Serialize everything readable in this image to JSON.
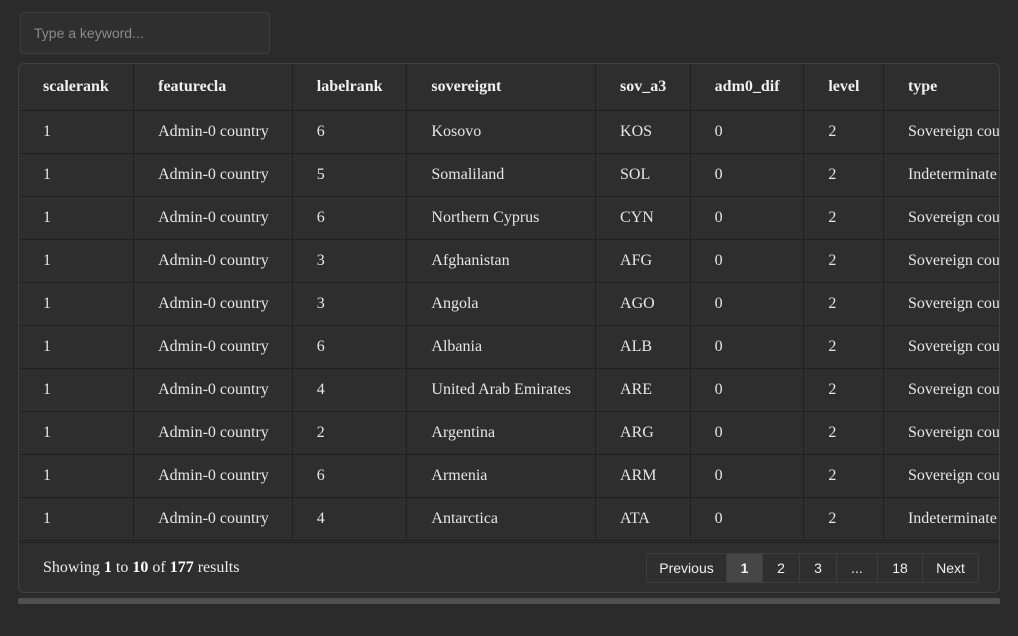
{
  "search": {
    "placeholder": "Type a keyword..."
  },
  "table": {
    "columns": [
      "scalerank",
      "featurecla",
      "labelrank",
      "sovereignt",
      "sov_a3",
      "adm0_dif",
      "level",
      "type"
    ],
    "rows": [
      [
        "1",
        "Admin-0 country",
        "6",
        "Kosovo",
        "KOS",
        "0",
        "2",
        "Sovereign cou"
      ],
      [
        "1",
        "Admin-0 country",
        "5",
        "Somaliland",
        "SOL",
        "0",
        "2",
        "Indeterminate"
      ],
      [
        "1",
        "Admin-0 country",
        "6",
        "Northern Cyprus",
        "CYN",
        "0",
        "2",
        "Sovereign cou"
      ],
      [
        "1",
        "Admin-0 country",
        "3",
        "Afghanistan",
        "AFG",
        "0",
        "2",
        "Sovereign cou"
      ],
      [
        "1",
        "Admin-0 country",
        "3",
        "Angola",
        "AGO",
        "0",
        "2",
        "Sovereign cou"
      ],
      [
        "1",
        "Admin-0 country",
        "6",
        "Albania",
        "ALB",
        "0",
        "2",
        "Sovereign cou"
      ],
      [
        "1",
        "Admin-0 country",
        "4",
        "United Arab Emirates",
        "ARE",
        "0",
        "2",
        "Sovereign cou"
      ],
      [
        "1",
        "Admin-0 country",
        "2",
        "Argentina",
        "ARG",
        "0",
        "2",
        "Sovereign cou"
      ],
      [
        "1",
        "Admin-0 country",
        "6",
        "Armenia",
        "ARM",
        "0",
        "2",
        "Sovereign cou"
      ],
      [
        "1",
        "Admin-0 country",
        "4",
        "Antarctica",
        "ATA",
        "0",
        "2",
        "Indeterminate"
      ]
    ]
  },
  "footer": {
    "showing_label": "Showing",
    "from": "1",
    "to_label": "to",
    "to": "10",
    "of_label": "of",
    "total": "177",
    "results_label": "results"
  },
  "pagination": {
    "previous": "Previous",
    "pages": [
      "1",
      "2",
      "3",
      "...",
      "18"
    ],
    "next": "Next",
    "active_page": "1"
  }
}
